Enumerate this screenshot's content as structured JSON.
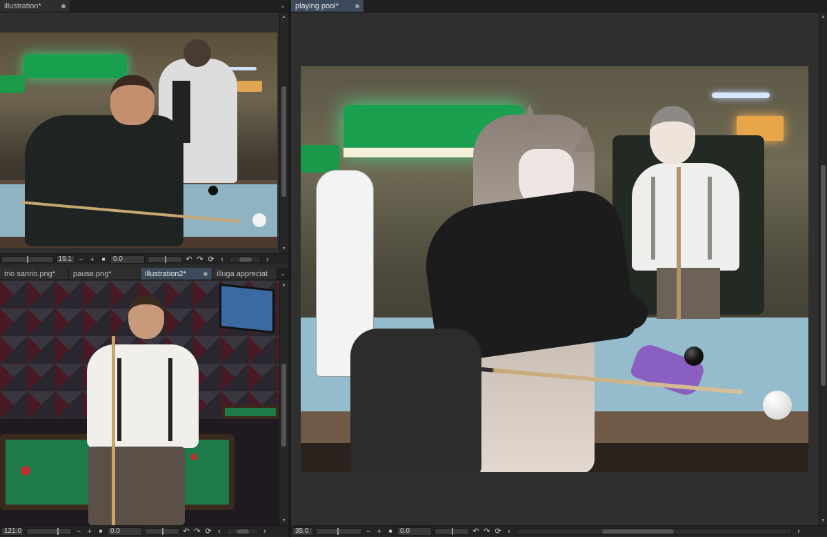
{
  "left_top_panel": {
    "tabs": [
      {
        "label": "illustration*",
        "active": false
      }
    ],
    "statusbar": {
      "zoom": "19.1",
      "angle": "0.0"
    }
  },
  "left_bottom_panel": {
    "tabs": [
      {
        "label": "trio sanrio.png*",
        "active": false
      },
      {
        "label": "pause.png*",
        "active": false
      },
      {
        "label": "illustration2*",
        "active": true
      },
      {
        "label": "illuga appreciat",
        "active": false
      }
    ],
    "statusbar": {
      "zoom": "121.0",
      "angle": "0.0"
    }
  },
  "right_panel": {
    "tabs": [
      {
        "label": "playing pool*",
        "active": true
      }
    ],
    "statusbar": {
      "zoom": "35.0",
      "angle": "0.0"
    }
  },
  "colors": {
    "active_tab": "#3c4a5c",
    "panel_bg": "#2f2f2f",
    "pool_felt_blue": "#8fb7c8",
    "pool_felt_green": "#1f7a4a",
    "lamp_green": "#1aa552"
  },
  "icons": {
    "zoom_out": "−",
    "zoom_in": "+",
    "stop": "■",
    "rotate_left": "↶",
    "rotate_right": "↷",
    "reset_rotation": "⟳",
    "scroll_left": "‹",
    "scroll_right": "›",
    "scroll_up": "▲",
    "scroll_down": "▼",
    "tab_menu": "⌄"
  }
}
